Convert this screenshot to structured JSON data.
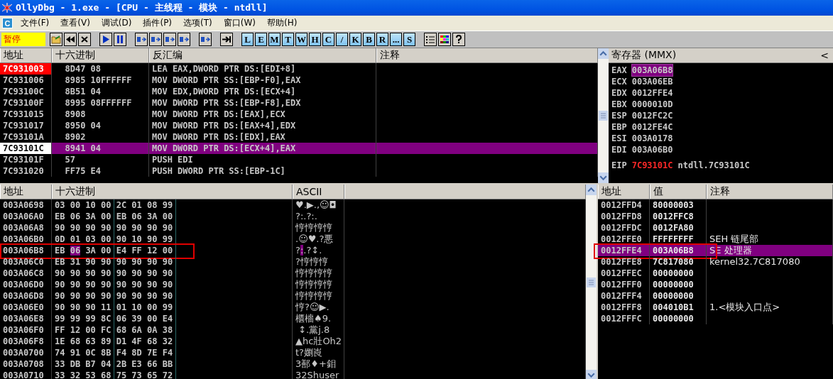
{
  "window": {
    "title": "OllyDbg - 1.exe - [CPU - 主线程 - 模块 - ntdll]"
  },
  "menu": {
    "app_button": "C",
    "items": [
      "文件(F)",
      "查看(V)",
      "调试(D)",
      "插件(P)",
      "选项(T)",
      "窗口(W)",
      "帮助(H)"
    ]
  },
  "toolbar": {
    "status": "暂停",
    "window_buttons": [
      "L",
      "E",
      "M",
      "T",
      "W",
      "H",
      "C",
      "/",
      "K",
      "B",
      "R",
      "...",
      "S"
    ]
  },
  "disassembly": {
    "columns": [
      "地址",
      "十六进制",
      "反汇编",
      "注释"
    ],
    "rows": [
      {
        "address": "7C931003",
        "hex": "8D47 08",
        "instruction": "LEA EAX,DWORD PTR DS:[EDI+8]",
        "breakpoint": true,
        "current": false,
        "selected": false
      },
      {
        "address": "7C931006",
        "hex": "8985 10FFFFFF",
        "instruction": "MOV DWORD PTR SS:[EBP-F0],EAX",
        "breakpoint": false,
        "current": false,
        "selected": false
      },
      {
        "address": "7C93100C",
        "hex": "8B51 04",
        "instruction": "MOV EDX,DWORD PTR DS:[ECX+4]",
        "breakpoint": false,
        "current": false,
        "selected": false
      },
      {
        "address": "7C93100F",
        "hex": "8995 08FFFFFF",
        "instruction": "MOV DWORD PTR SS:[EBP-F8],EDX",
        "breakpoint": false,
        "current": false,
        "selected": false
      },
      {
        "address": "7C931015",
        "hex": "8908",
        "instruction": "MOV DWORD PTR DS:[EAX],ECX",
        "breakpoint": false,
        "current": false,
        "selected": false
      },
      {
        "address": "7C931017",
        "hex": "8950 04",
        "instruction": "MOV DWORD PTR DS:[EAX+4],EDX",
        "breakpoint": false,
        "current": false,
        "selected": false
      },
      {
        "address": "7C93101A",
        "hex": "8902",
        "instruction": "MOV DWORD PTR DS:[EDX],EAX",
        "breakpoint": false,
        "current": false,
        "selected": false
      },
      {
        "address": "7C93101C",
        "hex": "8941 04",
        "instruction": "MOV DWORD PTR DS:[ECX+4],EAX",
        "breakpoint": false,
        "current": true,
        "selected": true
      },
      {
        "address": "7C93101F",
        "hex": "57",
        "instruction": "PUSH EDI",
        "breakpoint": false,
        "current": false,
        "selected": false
      },
      {
        "address": "7C931020",
        "hex": "FF75 E4",
        "instruction": "PUSH DWORD PTR SS:[EBP-1C]",
        "breakpoint": false,
        "current": false,
        "selected": false
      }
    ]
  },
  "registers": {
    "title": "寄存器 (MMX)",
    "collapse_button": "<",
    "rows": [
      {
        "name": "EAX",
        "value": "003A06B8",
        "selected": true
      },
      {
        "name": "ECX",
        "value": "003A06EB",
        "selected": false
      },
      {
        "name": "EDX",
        "value": "0012FFE4",
        "selected": false
      },
      {
        "name": "EBX",
        "value": "0000010D",
        "selected": false
      },
      {
        "name": "ESP",
        "value": "0012FC2C",
        "selected": false
      },
      {
        "name": "EBP",
        "value": "0012FE4C",
        "selected": false
      },
      {
        "name": "ESI",
        "value": "003A0178",
        "selected": false
      },
      {
        "name": "EDI",
        "value": "003A06B0",
        "selected": false
      }
    ],
    "eip": {
      "name": "EIP",
      "value": "7C93101C",
      "comment": "ntdll.7C93101C"
    }
  },
  "dump": {
    "columns": [
      "地址",
      "十六进制",
      "ASCII"
    ],
    "rows": [
      {
        "address": "003A0698",
        "hex": [
          {
            "text": "03 00 10 00 2C 01 08 99",
            "selected": false
          }
        ],
        "ascii": [
          {
            "text": "♥.▶.,☺◘",
            "selected": false
          }
        ],
        "boxed": false
      },
      {
        "address": "003A06A0",
        "hex": [
          {
            "text": "EB 06 3A 00 EB 06 3A 00",
            "selected": false
          }
        ],
        "ascii": [
          {
            "text": "?:.?:.",
            "selected": false
          }
        ],
        "boxed": false
      },
      {
        "address": "003A06A8",
        "hex": [
          {
            "text": "90 90 90 90 90 90 90 90",
            "selected": false
          }
        ],
        "ascii": [
          {
            "text": "悙悙悙悙",
            "selected": false
          }
        ],
        "boxed": false
      },
      {
        "address": "003A06B0",
        "hex": [
          {
            "text": "0D 01 03 00 90 10 90 99",
            "selected": false
          }
        ],
        "ascii": [
          {
            "text": ".☺♥.?悪",
            "selected": false
          }
        ],
        "boxed": false
      },
      {
        "address": "003A06B8",
        "hex": [
          {
            "text": "EB",
            "selected": false
          },
          {
            "text": "06",
            "selected": true
          },
          {
            "text": "3A 00 E4 FF 12 00",
            "selected": false
          }
        ],
        "ascii": [
          {
            "text": "?",
            "selected": false
          },
          {
            "text": ":",
            "selected": true
          },
          {
            "text": ".?↕.",
            "selected": false
          }
        ],
        "boxed": true
      },
      {
        "address": "003A06C0",
        "hex": [
          {
            "text": "EB 31 90 90 90 90 90 90",
            "selected": false
          }
        ],
        "ascii": [
          {
            "text": "?悙悙悙",
            "selected": false
          }
        ],
        "boxed": false
      },
      {
        "address": "003A06C8",
        "hex": [
          {
            "text": "90 90 90 90 90 90 90 90",
            "selected": false
          }
        ],
        "ascii": [
          {
            "text": "悙悙悙悙",
            "selected": false
          }
        ],
        "boxed": false
      },
      {
        "address": "003A06D0",
        "hex": [
          {
            "text": "90 90 90 90 90 90 90 90",
            "selected": false
          }
        ],
        "ascii": [
          {
            "text": "悙悙悙悙",
            "selected": false
          }
        ],
        "boxed": false
      },
      {
        "address": "003A06D8",
        "hex": [
          {
            "text": "90 90 90 90 90 90 90 90",
            "selected": false
          }
        ],
        "ascii": [
          {
            "text": "悙悙悙悙",
            "selected": false
          }
        ],
        "boxed": false
      },
      {
        "address": "003A06E0",
        "hex": [
          {
            "text": "90 90 90 11 01 10 00 99",
            "selected": false
          }
        ],
        "ascii": [
          {
            "text": "悙?☺▶.",
            "selected": false
          }
        ],
        "boxed": false
      },
      {
        "address": "003A06E8",
        "hex": [
          {
            "text": "99 99 99 8C 06 39 00 E4",
            "selected": false
          }
        ],
        "ascii": [
          {
            "text": "櫃檣♠9.",
            "selected": false
          }
        ],
        "boxed": false
      },
      {
        "address": "003A06F0",
        "hex": [
          {
            "text": "FF 12 00 FC 68 6A 0A 38",
            "selected": false
          }
        ],
        "ascii": [
          {
            "text": " ↕.黨j.8",
            "selected": false
          }
        ],
        "boxed": false
      },
      {
        "address": "003A06F8",
        "hex": [
          {
            "text": "1E 68 63 89 D1 4F 68 32",
            "selected": false
          }
        ],
        "ascii": [
          {
            "text": "▲hc壯Oh2",
            "selected": false
          }
        ],
        "boxed": false
      },
      {
        "address": "003A0700",
        "hex": [
          {
            "text": "74 91 0C 8B F4 8D 7E F4",
            "selected": false
          }
        ],
        "ascii": [
          {
            "text": "t?嬼崀",
            "selected": false
          }
        ],
        "boxed": false
      },
      {
        "address": "003A0708",
        "hex": [
          {
            "text": "33 DB B7 04 2B E3 66 BB",
            "selected": false
          }
        ],
        "ascii": [
          {
            "text": "3鄯♦+鉬",
            "selected": false
          }
        ],
        "boxed": false
      },
      {
        "address": "003A0710",
        "hex": [
          {
            "text": "33 32 53 68 75 73 65 72",
            "selected": false
          }
        ],
        "ascii": [
          {
            "text": "32Shuser",
            "selected": false
          }
        ],
        "boxed": false
      }
    ]
  },
  "stack": {
    "columns": [
      "地址",
      "值",
      "注释"
    ],
    "rows": [
      {
        "address": "0012FFD4",
        "value": "80000003",
        "selected": false,
        "boxed": false
      },
      {
        "address": "0012FFD8",
        "value": "0012FFC8",
        "selected": false,
        "boxed": false
      },
      {
        "address": "0012FFDC",
        "value": "0012FA80",
        "selected": false,
        "boxed": false
      },
      {
        "address": "0012FFE0",
        "value": "FFFFFFFF",
        "comment": "SEH 链尾部",
        "selected": false,
        "boxed": false
      },
      {
        "address": "0012FFE4",
        "value": "003A06B8",
        "comment": "SE 处理器",
        "selected": true,
        "boxed": true
      },
      {
        "address": "0012FFE8",
        "value": "7C817080",
        "comment": "kernel32.7C817080",
        "selected": false,
        "boxed": false
      },
      {
        "address": "0012FFEC",
        "value": "00000000",
        "selected": false,
        "boxed": false
      },
      {
        "address": "0012FFF0",
        "value": "00000000",
        "selected": false,
        "boxed": false
      },
      {
        "address": "0012FFF4",
        "value": "00000000",
        "selected": false,
        "boxed": false
      },
      {
        "address": "0012FFF8",
        "value": "004010B1",
        "comment": "1.<模块入口点>",
        "selected": false,
        "boxed": false
      },
      {
        "address": "0012FFFC",
        "value": "00000000",
        "selected": false,
        "boxed": false
      }
    ]
  }
}
